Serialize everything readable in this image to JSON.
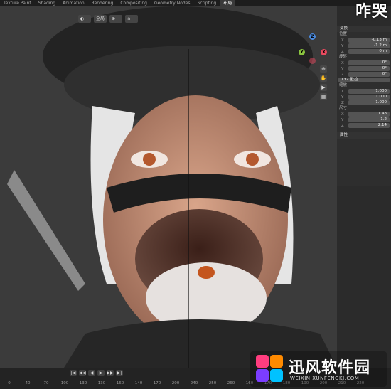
{
  "tabs": [
    "Texture Paint",
    "Shading",
    "Animation",
    "Rendering",
    "Compositing",
    "Geometry Nodes",
    "Scripting",
    "布局"
  ],
  "active_tab_index": 7,
  "top_watermark": "咋哭",
  "viewport_toolbar": [
    "◐",
    "全局",
    "⊕",
    "∩"
  ],
  "nav_gizmo": {
    "x": "X",
    "y": "Y",
    "z": "Z"
  },
  "view_tools": [
    "⊕",
    "✋",
    "▶",
    "▦"
  ],
  "transform_panel": {
    "title": "变换",
    "location_label": "位置",
    "location": [
      {
        "axis": "X",
        "value": "-0.13 m"
      },
      {
        "axis": "Y",
        "value": "-1.2 m"
      },
      {
        "axis": "Z",
        "value": "0 m"
      }
    ],
    "rotation_label": "旋转",
    "rotation": [
      {
        "axis": "X",
        "value": "0°"
      },
      {
        "axis": "Y",
        "value": "0°"
      },
      {
        "axis": "Z",
        "value": "0°"
      }
    ],
    "rotation_mode": "XYZ 欧拉",
    "scale_label": "缩放",
    "scale": [
      {
        "axis": "X",
        "value": "1.000"
      },
      {
        "axis": "Y",
        "value": "1.000"
      },
      {
        "axis": "Z",
        "value": "1.000"
      }
    ],
    "dimensions_label": "尺寸",
    "dimensions": [
      {
        "axis": "X",
        "value": "1.48"
      },
      {
        "axis": "Y",
        "value": "1.2"
      },
      {
        "axis": "Z",
        "value": "2.14"
      }
    ],
    "properties_label": "属性"
  },
  "timeline": {
    "controls": [
      "|◀",
      "◀◀",
      "◀",
      "▶",
      "▶▶",
      "▶|"
    ],
    "ticks": [
      "0",
      "40",
      "70",
      "100",
      "130",
      "130",
      "160",
      "140",
      "170",
      "200",
      "240",
      "250",
      "260",
      "160",
      "170",
      "180",
      "190",
      "200",
      "210",
      "220"
    ]
  },
  "logo": {
    "name": "迅风软件园",
    "url": "WEIXIN.XUNFENGKJ.COM"
  },
  "colors": {
    "accent": "#ff6a00",
    "axis_x": "#e84a5f",
    "axis_y": "#8ac43f",
    "axis_z": "#4b8be0"
  }
}
